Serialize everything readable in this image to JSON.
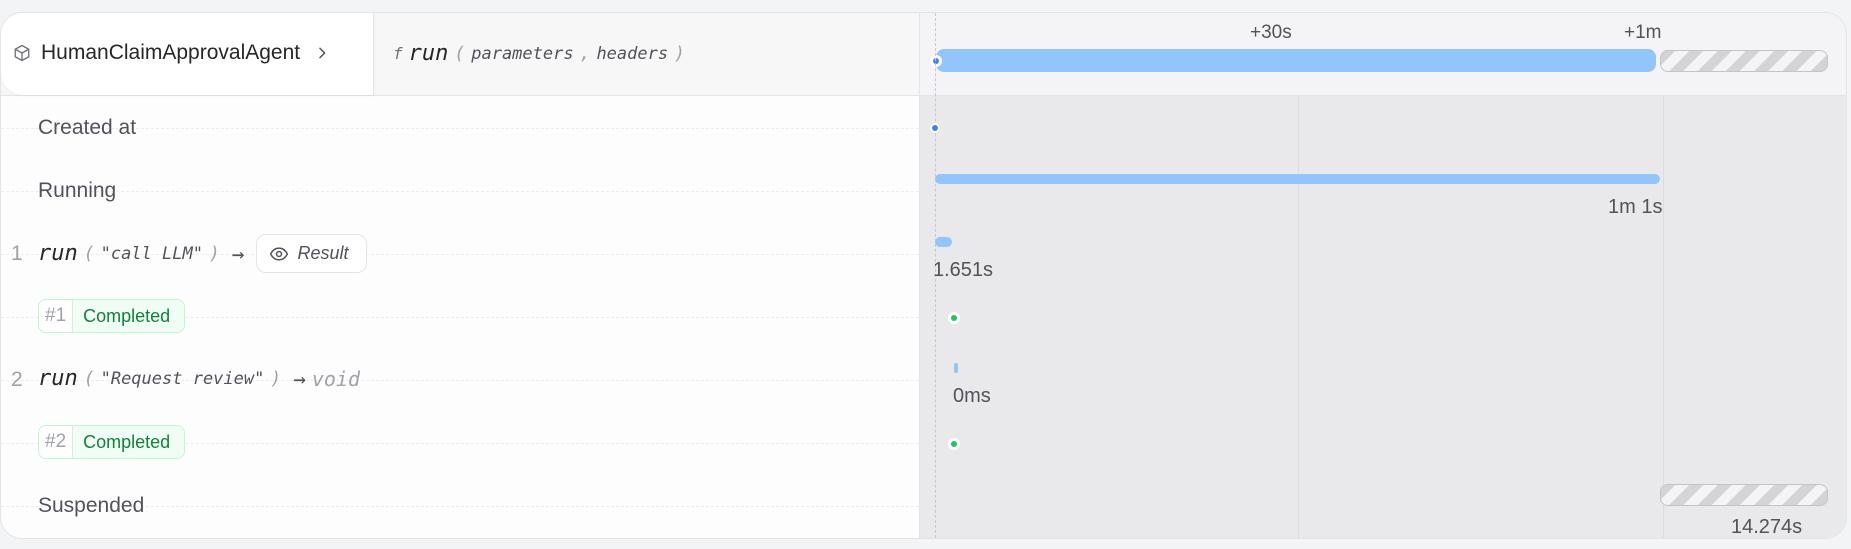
{
  "header": {
    "agent_name": "HumanClaimApprovalAgent",
    "function_prefix": "f",
    "function_name": "run",
    "param1": "parameters",
    "param2": "headers"
  },
  "timeline": {
    "ticks": [
      "+30s",
      "+1m"
    ],
    "total_duration": "1m 1s",
    "suspended_duration": "14.274s"
  },
  "rows": {
    "created_label": "Created at",
    "running_label": "Running",
    "suspended_label": "Suspended",
    "step1": {
      "number": "1",
      "fn": "run",
      "arg": "\"call LLM\"",
      "result_label": "Result",
      "duration": "1.651s",
      "attempt": "#1",
      "status": "Completed"
    },
    "step2": {
      "number": "2",
      "fn": "run",
      "arg": "\"Request review\"",
      "return_type": "void",
      "duration": "0ms",
      "attempt": "#2",
      "status": "Completed"
    }
  },
  "colors": {
    "bar_blue": "#93c5fd",
    "dot_blue": "#3b82f6",
    "status_green": "#15803d",
    "dot_green": "#22c55e"
  }
}
